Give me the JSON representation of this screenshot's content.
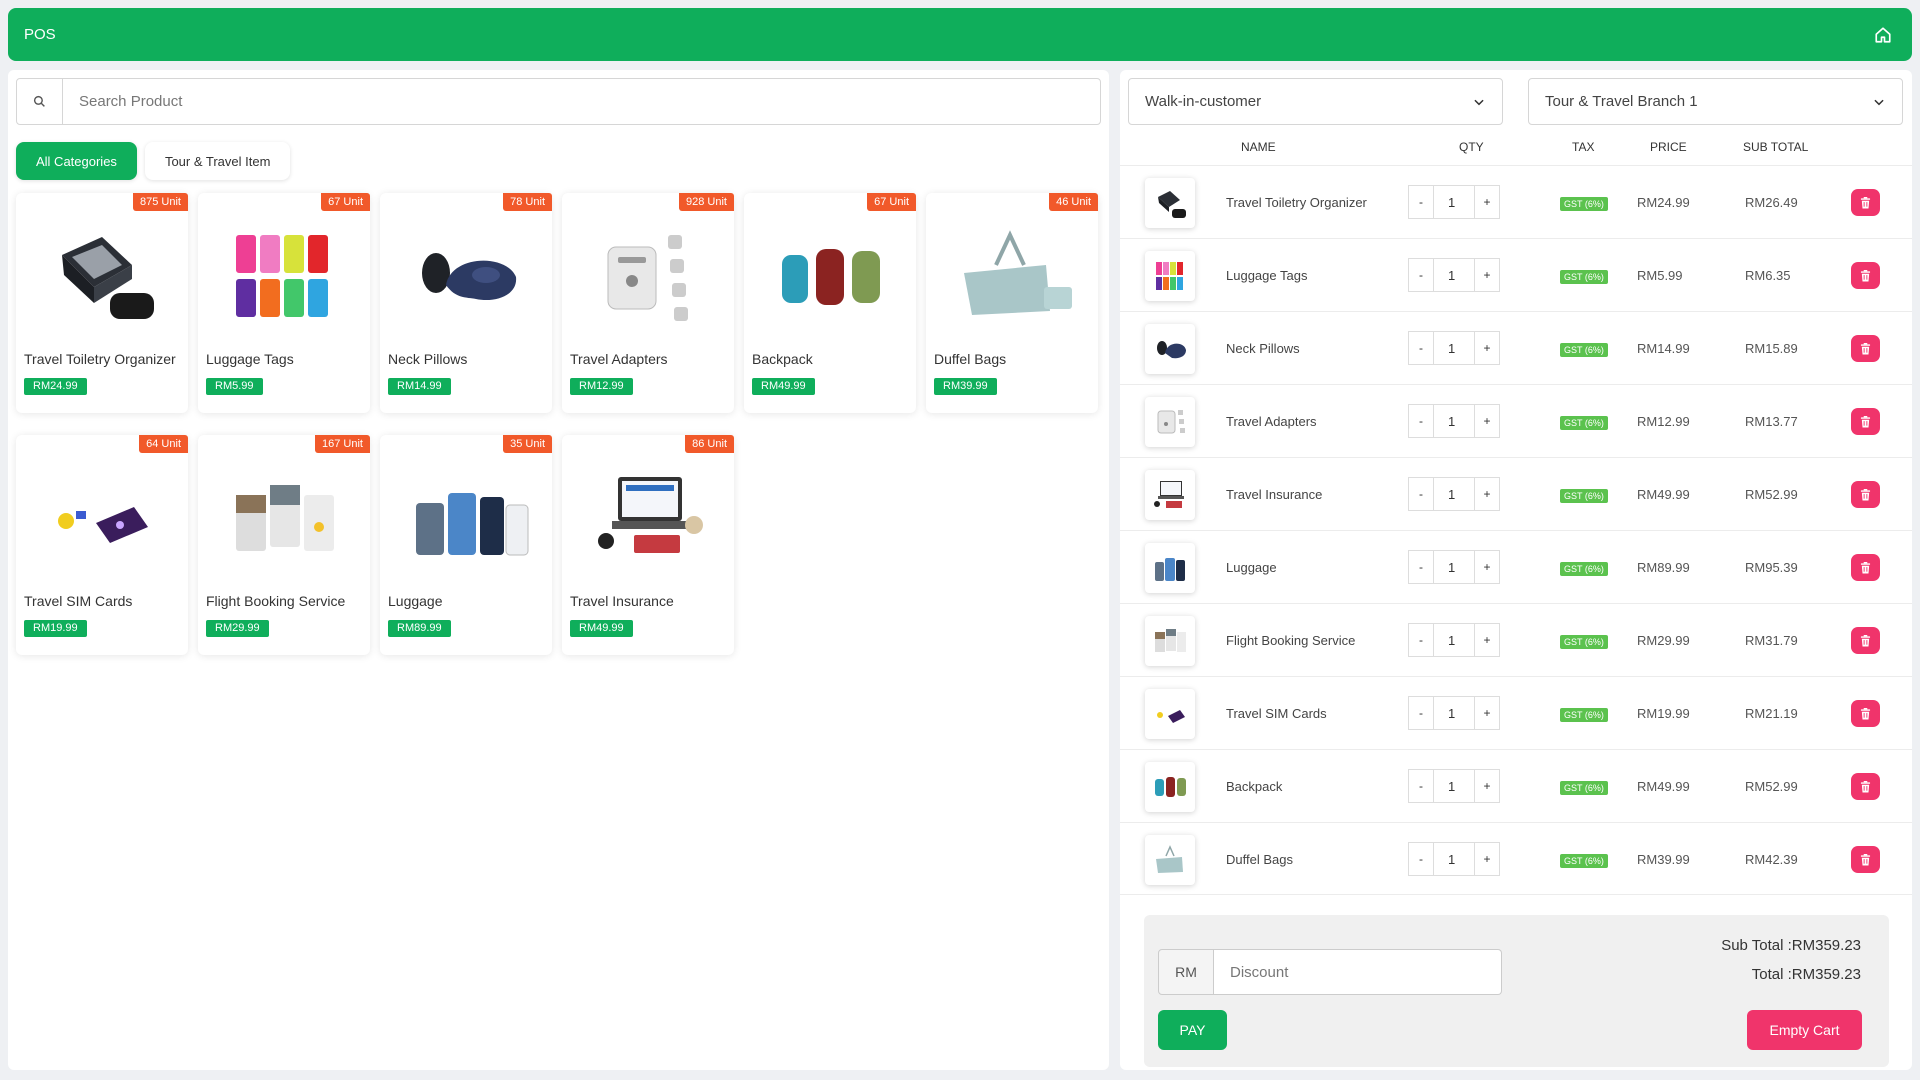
{
  "header": {
    "title": "POS",
    "home_icon": "home-icon"
  },
  "search": {
    "placeholder": "Search Product",
    "icon": "search-icon"
  },
  "categories": [
    {
      "label": "All Categories",
      "active": true
    },
    {
      "label": "Tour & Travel Item",
      "active": false
    }
  ],
  "products": [
    {
      "name": "Travel Toiletry Organizer",
      "price": "RM24.99",
      "stock": "875 Unit",
      "icon": "toiletry-bag-icon"
    },
    {
      "name": "Luggage Tags",
      "price": "RM5.99",
      "stock": "67 Unit",
      "icon": "luggage-tag-icon"
    },
    {
      "name": "Neck Pillows",
      "price": "RM14.99",
      "stock": "78 Unit",
      "icon": "neck-pillow-icon"
    },
    {
      "name": "Travel Adapters",
      "price": "RM12.99",
      "stock": "928 Unit",
      "icon": "travel-adapter-icon"
    },
    {
      "name": "Backpack",
      "price": "RM49.99",
      "stock": "67 Unit",
      "icon": "backpack-icon"
    },
    {
      "name": "Duffel Bags",
      "price": "RM39.99",
      "stock": "46 Unit",
      "icon": "duffel-bag-icon"
    },
    {
      "name": "Travel SIM Cards",
      "price": "RM19.99",
      "stock": "64 Unit",
      "icon": "sim-card-icon"
    },
    {
      "name": "Flight Booking Service",
      "price": "RM29.99",
      "stock": "167 Unit",
      "icon": "flight-booking-icon"
    },
    {
      "name": "Luggage",
      "price": "RM89.99",
      "stock": "35 Unit",
      "icon": "luggage-icon"
    },
    {
      "name": "Travel Insurance",
      "price": "RM49.99",
      "stock": "86 Unit",
      "icon": "travel-insurance-icon"
    }
  ],
  "cart": {
    "customer_select": "Walk-in-customer",
    "branch_select": "Tour & Travel Branch 1",
    "columns": {
      "name": "NAME",
      "qty": "QTY",
      "tax": "TAX",
      "price": "PRICE",
      "subtotal": "SUB TOTAL"
    },
    "items": [
      {
        "name": "Travel Toiletry Organizer",
        "qty": "1",
        "tax": "GST (6%)",
        "price": "RM24.99",
        "subtotal": "RM26.49",
        "icon": "toiletry-bag-icon"
      },
      {
        "name": "Luggage Tags",
        "qty": "1",
        "tax": "GST (6%)",
        "price": "RM5.99",
        "subtotal": "RM6.35",
        "icon": "luggage-tag-icon"
      },
      {
        "name": "Neck Pillows",
        "qty": "1",
        "tax": "GST (6%)",
        "price": "RM14.99",
        "subtotal": "RM15.89",
        "icon": "neck-pillow-icon"
      },
      {
        "name": "Travel Adapters",
        "qty": "1",
        "tax": "GST (6%)",
        "price": "RM12.99",
        "subtotal": "RM13.77",
        "icon": "travel-adapter-icon"
      },
      {
        "name": "Travel Insurance",
        "qty": "1",
        "tax": "GST (6%)",
        "price": "RM49.99",
        "subtotal": "RM52.99",
        "icon": "travel-insurance-icon"
      },
      {
        "name": "Luggage",
        "qty": "1",
        "tax": "GST (6%)",
        "price": "RM89.99",
        "subtotal": "RM95.39",
        "icon": "luggage-icon"
      },
      {
        "name": "Flight Booking Service",
        "qty": "1",
        "tax": "GST (6%)",
        "price": "RM29.99",
        "subtotal": "RM31.79",
        "icon": "flight-booking-icon"
      },
      {
        "name": "Travel SIM Cards",
        "qty": "1",
        "tax": "GST (6%)",
        "price": "RM19.99",
        "subtotal": "RM21.19",
        "icon": "sim-card-icon"
      },
      {
        "name": "Backpack",
        "qty": "1",
        "tax": "GST (6%)",
        "price": "RM49.99",
        "subtotal": "RM52.99",
        "icon": "backpack-icon"
      },
      {
        "name": "Duffel Bags",
        "qty": "1",
        "tax": "GST (6%)",
        "price": "RM39.99",
        "subtotal": "RM42.39",
        "icon": "duffel-bag-icon"
      }
    ],
    "minus_label": "-",
    "plus_label": "+"
  },
  "summary": {
    "currency_label": "RM",
    "discount_placeholder": "Discount",
    "subtotal_text": "Sub Total :RM359.23",
    "total_text": "Total :RM359.23",
    "pay_label": "PAY",
    "empty_label": "Empty Cart"
  },
  "colors": {
    "brand": "#0fae5b",
    "stock_badge": "#f1592a",
    "danger": "#f0346b",
    "tax_badge": "#5bc24e"
  }
}
